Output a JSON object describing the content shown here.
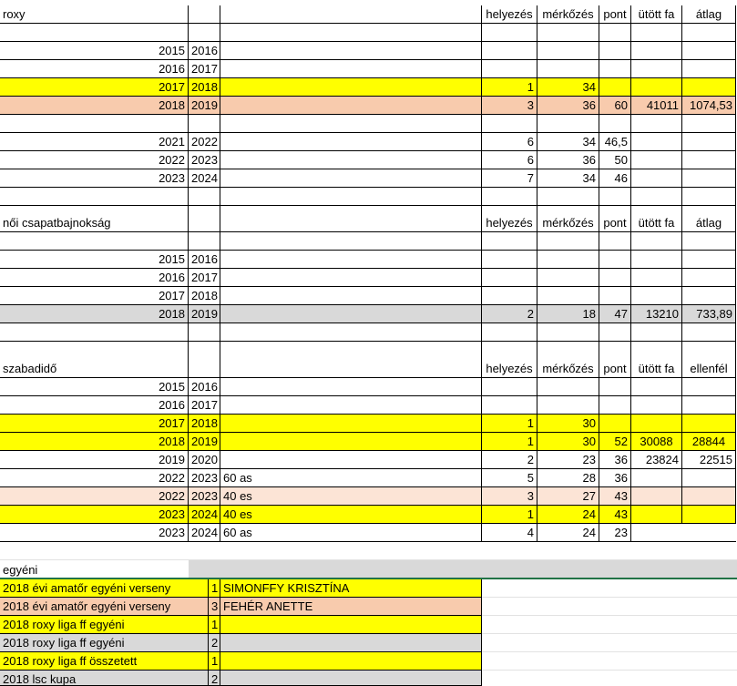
{
  "sections": {
    "roxy": {
      "title": "roxy",
      "headers": {
        "helyezes": "helyezés",
        "merkozes": "mérkőzés",
        "pont": "pont",
        "utott_fa": "ütött fa",
        "last": "átlag"
      },
      "rows": [
        {
          "y1": "2015",
          "y2": "2016",
          "h": "",
          "m": "",
          "p": "",
          "u": "",
          "a": ""
        },
        {
          "y1": "2016",
          "y2": "2017",
          "h": "",
          "m": "",
          "p": "",
          "u": "",
          "a": ""
        },
        {
          "y1": "2017",
          "y2": "2018",
          "h": "1",
          "m": "34",
          "p": "",
          "u": "",
          "a": ""
        },
        {
          "y1": "2018",
          "y2": "2019",
          "h": "3",
          "m": "36",
          "p": "60",
          "u": "41011",
          "a": "1074,53"
        },
        {
          "y1": "2021",
          "y2": "2022",
          "h": "6",
          "m": "34",
          "p": "46,5",
          "u": "",
          "a": ""
        },
        {
          "y1": "2022",
          "y2": "2023",
          "h": "6",
          "m": "36",
          "p": "50",
          "u": "",
          "a": ""
        },
        {
          "y1": "2023",
          "y2": "2024",
          "h": "7",
          "m": "34",
          "p": "46",
          "u": "",
          "a": ""
        }
      ]
    },
    "noi": {
      "title": "női csapatbajnokság",
      "headers": {
        "helyezes": "helyezés",
        "merkozes": "mérkőzés",
        "pont": "pont",
        "utott_fa": "ütött fa",
        "last": "átlag"
      },
      "rows": [
        {
          "y1": "2015",
          "y2": "2016",
          "h": "",
          "m": "",
          "p": "",
          "u": "",
          "a": ""
        },
        {
          "y1": "2016",
          "y2": "2017",
          "h": "",
          "m": "",
          "p": "",
          "u": "",
          "a": ""
        },
        {
          "y1": "2017",
          "y2": "2018",
          "h": "",
          "m": "",
          "p": "",
          "u": "",
          "a": ""
        },
        {
          "y1": "2018",
          "y2": "2019",
          "h": "2",
          "m": "18",
          "p": "47",
          "u": "13210",
          "a": "733,89"
        }
      ]
    },
    "szabadido": {
      "title": "szabadidő",
      "headers": {
        "helyezes": "helyezés",
        "merkozes": "mérkőzés",
        "pont": "pont",
        "utott_fa": "ütött fa",
        "last": "ellenfél"
      },
      "rows": [
        {
          "y1": "2015",
          "y2": "2016",
          "note": "",
          "h": "",
          "m": "",
          "p": "",
          "u": "",
          "e": ""
        },
        {
          "y1": "2016",
          "y2": "2017",
          "note": "",
          "h": "",
          "m": "",
          "p": "",
          "u": "",
          "e": ""
        },
        {
          "y1": "2017",
          "y2": "2018",
          "note": "",
          "h": "1",
          "m": "30",
          "p": "",
          "u": "",
          "e": ""
        },
        {
          "y1": "2018",
          "y2": "2019",
          "note": "",
          "h": "1",
          "m": "30",
          "p": "52",
          "u": "30088",
          "e": "28844"
        },
        {
          "y1": "2019",
          "y2": "2020",
          "note": "",
          "h": "2",
          "m": "23",
          "p": "36",
          "u": "23824",
          "e": "22515"
        },
        {
          "y1": "2022",
          "y2": "2023",
          "note": "60 as",
          "h": "5",
          "m": "28",
          "p": "36",
          "u": "",
          "e": ""
        },
        {
          "y1": "2022",
          "y2": "2023",
          "note": "40 es",
          "h": "3",
          "m": "27",
          "p": "43",
          "u": "",
          "e": ""
        },
        {
          "y1": "2023",
          "y2": "2024",
          "note": "40 es",
          "h": "1",
          "m": "24",
          "p": "43",
          "u": "",
          "e": ""
        },
        {
          "y1": "2023",
          "y2": "2024",
          "note": "60 as",
          "h": "4",
          "m": "24",
          "p": "23",
          "u": "",
          "e": ""
        }
      ]
    },
    "egyeni": {
      "title": "egyéni",
      "rows": [
        {
          "event": "2018 évi amatőr egyéni verseny",
          "place": "1",
          "name": "SIMONFFY KRISZTÍNA"
        },
        {
          "event": "2018 évi amatőr egyéni verseny",
          "place": "3",
          "name": "FEHÉR ANETTE"
        },
        {
          "event": "2018 roxy liga ff egyéni",
          "place": "1",
          "name": ""
        },
        {
          "event": "2018 roxy liga ff egyéni",
          "place": "2",
          "name": ""
        },
        {
          "event": "2018 roxy liga ff összetett",
          "place": "1",
          "name": ""
        },
        {
          "event": "2018 lsc kupa",
          "place": "2",
          "name": ""
        }
      ]
    }
  },
  "colors": {
    "yellow": "#ffff00",
    "peach": "#f8cbad",
    "light_peach": "#fce4d6",
    "gray": "#d9d9d9",
    "green_border": "#217346"
  }
}
